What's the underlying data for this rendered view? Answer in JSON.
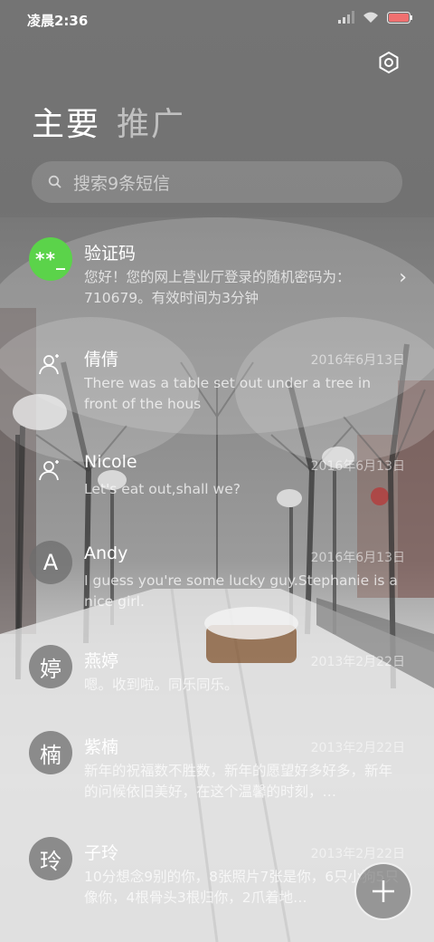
{
  "status_bar": {
    "time": "凌晨2:36"
  },
  "tabs": [
    {
      "label": "主要"
    },
    {
      "label": "推广"
    }
  ],
  "search": {
    "placeholder": "搜索9条短信"
  },
  "messages": [
    {
      "name": "验证码",
      "avatar_text": "**_",
      "avatar_type": "green",
      "date": "",
      "preview": "您好！您的网上营业厅登录的随机密码为：710679。有效时间为3分钟"
    },
    {
      "name": "倩倩",
      "avatar_text": "",
      "avatar_type": "contact-icon",
      "date": "2016年6月13日",
      "preview": "There was a table set out under a tree in front of the hous"
    },
    {
      "name": "Nicole",
      "avatar_text": "",
      "avatar_type": "contact-icon",
      "date": "2016年6月13日",
      "preview": "Let's eat out,shall we?"
    },
    {
      "name": "Andy",
      "avatar_text": "A",
      "avatar_type": "letter",
      "date": "2016年6月13日",
      "preview": "I guess you're some lucky guy.Stephanie is a nice girl."
    },
    {
      "name": "燕婷",
      "avatar_text": "婷",
      "avatar_type": "letter",
      "date": "2013年2月22日",
      "preview": "嗯。收到啦。同乐同乐。"
    },
    {
      "name": "紫楠",
      "avatar_text": "楠",
      "avatar_type": "letter",
      "date": "2013年2月22日",
      "preview": "新年的祝福数不胜数，新年的愿望好多好多，新年的问候依旧美好，在这个温馨的时刻，…"
    },
    {
      "name": "子玲",
      "avatar_text": "玲",
      "avatar_type": "letter",
      "date": "2013年2月22日",
      "preview": "10分想念9别的你，8张照片7张是你，6只小狗5只像你，4根骨头3根归你，2爪着地…"
    }
  ],
  "icons": {
    "settings": "gear-icon",
    "search": "search-icon",
    "compose": "plus-icon",
    "chevron": "chevron-right-icon"
  },
  "colors": {
    "verify_avatar": "#5bd34a"
  }
}
